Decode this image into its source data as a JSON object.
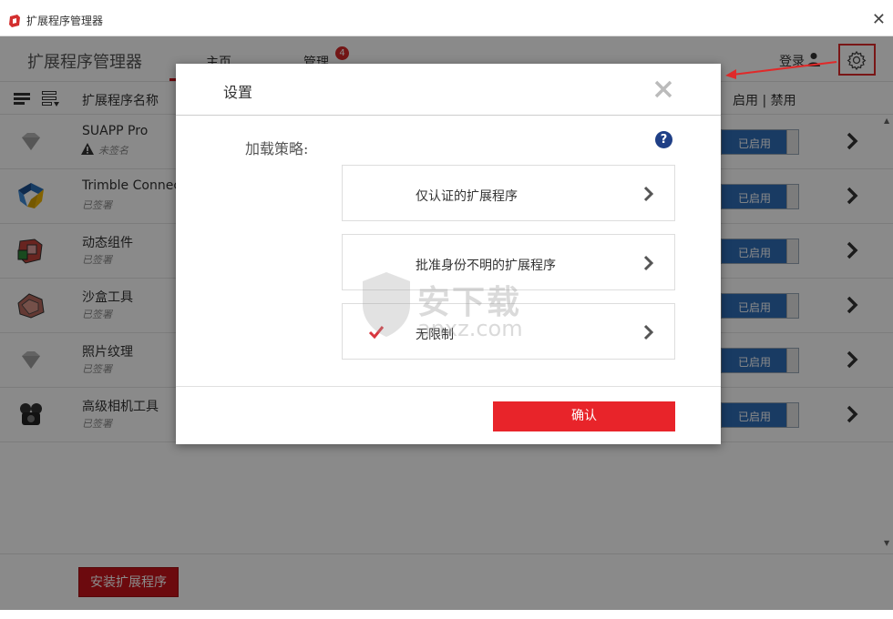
{
  "window": {
    "title": "扩展程序管理器",
    "close_glyph": "✕"
  },
  "nav": {
    "app_name": "扩展程序管理器",
    "tabs": [
      {
        "label": "主页"
      },
      {
        "label": "管理"
      }
    ],
    "manage_badge": "4",
    "login": "登录"
  },
  "columns": {
    "name": "扩展程序名称",
    "toggle": "启用 | 禁用"
  },
  "extensions": [
    {
      "name": "SUAPP Pro",
      "status": "未签名",
      "toggle": "已启用",
      "icon": "gem-icon"
    },
    {
      "name": "Trimble Connec",
      "status": "已签署",
      "toggle": "已启用",
      "icon": "trimble-icon"
    },
    {
      "name": "动态组件",
      "status": "已签署",
      "toggle": "已启用",
      "icon": "dynamic-components-icon"
    },
    {
      "name": "沙盒工具",
      "status": "已签署",
      "toggle": "已启用",
      "icon": "sandbox-icon"
    },
    {
      "name": "照片纹理",
      "status": "已签署",
      "toggle": "已启用",
      "icon": "gem-icon"
    },
    {
      "name": "高级相机工具",
      "status": "已签署",
      "toggle": "已启用",
      "icon": "camera-tools-icon"
    }
  ],
  "install_button": "安装扩展程序",
  "dialog": {
    "title": "设置",
    "policy_label": "加载策略:",
    "help": "?",
    "options": [
      {
        "label": "仅认证的扩展程序",
        "selected": false
      },
      {
        "label": "批准身份不明的扩展程序",
        "selected": false
      },
      {
        "label": "无限制",
        "selected": true
      }
    ],
    "confirm": "确认"
  },
  "watermark": {
    "text": "安下载",
    "sub": "anxz.com"
  },
  "colors": {
    "brand_red": "#c8141b",
    "toggle_blue": "#2f6db7",
    "confirm_red": "#e8242a",
    "help_blue": "#1f3f86"
  }
}
